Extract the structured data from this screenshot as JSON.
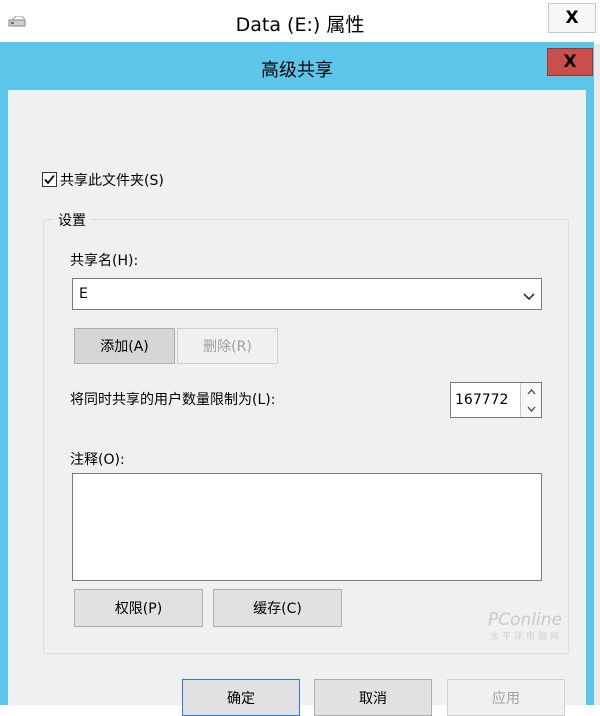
{
  "outer_window": {
    "title": "Data (E:) 属性",
    "close_glyph": "X"
  },
  "dialog": {
    "title": "高级共享",
    "close_glyph": "X",
    "share_checkbox": {
      "label": "共享此文件夹(S)",
      "checked": true
    },
    "settings": {
      "legend": "设置",
      "share_name_label": "共享名(H):",
      "share_name_value": "E",
      "add_button": "添加(A)",
      "remove_button": "删除(R)",
      "user_limit_label": "将同时共享的用户数量限制为(L):",
      "user_limit_value": "167772",
      "comments_label": "注释(O):",
      "comments_value": "",
      "permissions_button": "权限(P)",
      "caching_button": "缓存(C)"
    },
    "buttons": {
      "ok": "确定",
      "cancel": "取消",
      "apply": "应用"
    }
  },
  "watermark": {
    "brand": "PConline",
    "sub": "太平洋电脑网"
  },
  "colors": {
    "titlebar_accent": "#5bc6ea",
    "close_button": "#c9504a",
    "client_background": "#f0f0f0"
  }
}
